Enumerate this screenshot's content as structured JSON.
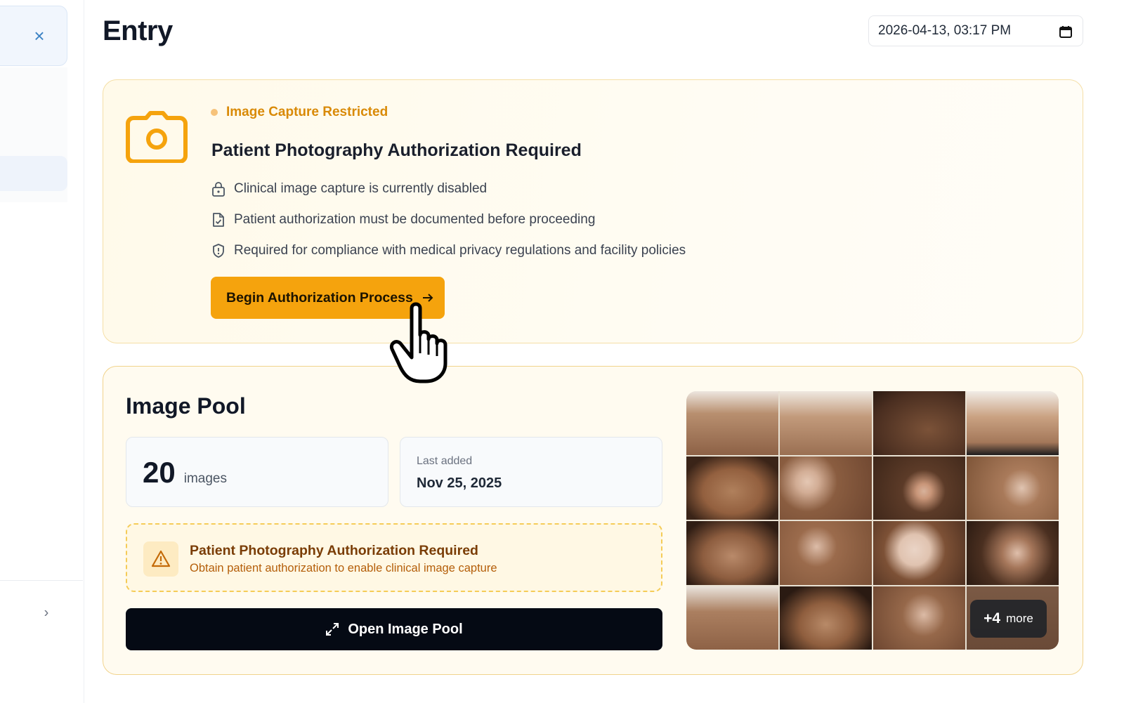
{
  "header": {
    "title": "Entry",
    "datetime_value": "2026-04-13, 03:17 PM"
  },
  "sidebar": {
    "close_icon": "close-icon",
    "expand_icon": "chevron-right-icon"
  },
  "auth_card": {
    "status_label": "Image Capture Restricted",
    "title": "Patient Photography Authorization Required",
    "requirements": [
      {
        "icon": "lock-icon",
        "text": "Clinical image capture is currently disabled"
      },
      {
        "icon": "document-check-icon",
        "text": "Patient authorization must be documented before proceeding"
      },
      {
        "icon": "shield-icon",
        "text": "Required for compliance with medical privacy regulations and facility policies"
      }
    ],
    "button_label": "Begin Authorization Process"
  },
  "image_pool": {
    "title": "Image Pool",
    "count": "20",
    "count_unit": "images",
    "last_added_label": "Last added",
    "last_added_value": "Nov 25, 2025",
    "warning_title": "Patient Photography Authorization Required",
    "warning_subtitle": "Obtain patient authorization to enable clinical image capture",
    "open_button_label": "Open Image Pool",
    "more_count": "+4",
    "more_label": "more",
    "thumbnails": [
      "hands",
      "hands",
      "neck",
      "forearms",
      "face",
      "hand-patches",
      "neck-patch",
      "wrists",
      "face-patches",
      "hands-patches",
      "skin-patches",
      "neck-spots",
      "wrists-patches",
      "face",
      "hand-patches",
      "hands"
    ]
  },
  "colors": {
    "accent": "#f5a30d",
    "status_text": "#d98a07",
    "warning_text": "#7a3d06",
    "primary_button": "#050a14"
  }
}
